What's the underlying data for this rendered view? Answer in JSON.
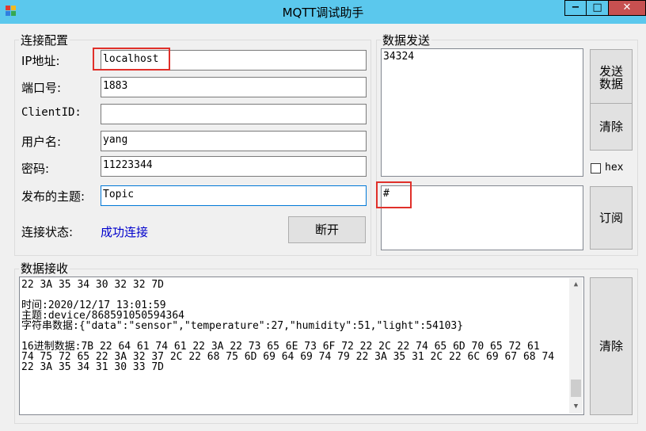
{
  "window": {
    "title": "MQTT调试助手",
    "minimize": "−",
    "maximize": "□",
    "close": "✕"
  },
  "connection": {
    "group_title": "连接配置",
    "ip_label": "IP地址:",
    "ip_value": "localhost",
    "port_label": "端口号:",
    "port_value": "1883",
    "clientid_label": "ClientID:",
    "clientid_value": "",
    "username_label": "用户名:",
    "username_value": "yang",
    "password_label": "密码:",
    "password_value": "11223344",
    "topic_label": "发布的主题:",
    "topic_value": "Topic",
    "status_label": "连接状态:",
    "status_value": "成功连接",
    "disconnect_button": "断开"
  },
  "send": {
    "group_title": "数据发送",
    "content": "34324",
    "send_button_line1": "发送",
    "send_button_line2": "数据",
    "clear_button": "清除",
    "hex_label": "hex",
    "hex_checked": false,
    "subscribe_topic": "#",
    "subscribe_button": "订阅"
  },
  "receive": {
    "group_title": "数据接收",
    "lines": [
      "22 3A 35 34 30 32 32 7D",
      "",
      "时间:2020/12/17 13:01:59",
      "主题:device/868591050594364",
      "字符串数据:{\"data\":\"sensor\",\"temperature\":27,\"humidity\":51,\"light\":54103}",
      "",
      "16进制数据:7B 22 64 61 74 61 22 3A 22 73 65 6E 73 6F 72 22 2C 22 74 65 6D 70 65 72 61",
      "74 75 72 65 22 3A 32 37 2C 22 68 75 6D 69 64 69 74 79 22 3A 35 31 2C 22 6C 69 67 68 74",
      "22 3A 35 34 31 30 33 7D"
    ],
    "clear_button": "清除",
    "scroll_position": 0.95
  },
  "colors": {
    "titlebar": "#5bc8ed",
    "status_text": "#0000cc",
    "highlight": "#e0302a"
  }
}
